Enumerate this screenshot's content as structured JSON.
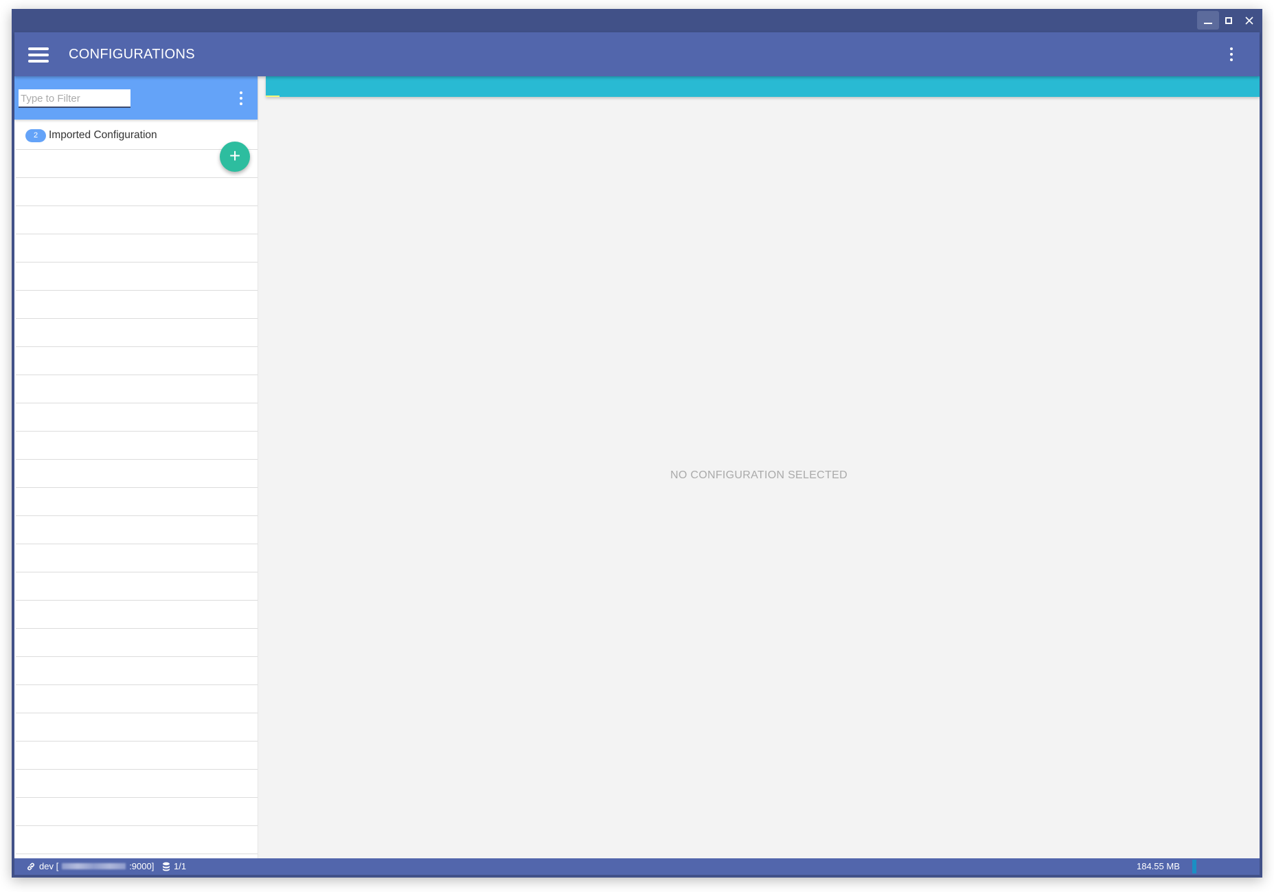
{
  "window": {
    "controls": {
      "minimize": "minimize",
      "maximize": "maximize",
      "close": "close"
    }
  },
  "appbar": {
    "title": "CONFIGURATIONS",
    "menu_icon": "hamburger-menu-icon",
    "more_icon": "more-vertical-icon"
  },
  "sidebar": {
    "filter": {
      "placeholder": "Type to Filter",
      "value": ""
    },
    "more_icon": "more-vertical-icon",
    "items": [
      {
        "badge": "2",
        "label": "Imported Configuration"
      }
    ],
    "add_button": {
      "icon": "plus-icon",
      "label": "+"
    }
  },
  "content": {
    "empty_message": "NO CONFIGURATION SELECTED"
  },
  "statusbar": {
    "connection": {
      "icon": "link-icon",
      "prefix": "dev [",
      "suffix": ":9000]"
    },
    "database": {
      "icon": "database-icon",
      "value": "1/1"
    },
    "memory": {
      "value": "184.55 MB"
    }
  }
}
